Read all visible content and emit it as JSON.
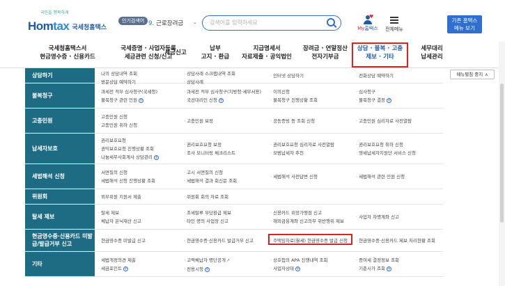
{
  "header": {
    "logo_tagline": "국민을 행복하게",
    "logo_home": "Hom",
    "logo_tax": "tax",
    "logo_sub": "국세청홈택스",
    "popular_badge": "인기검색어",
    "popular_num": "9.",
    "popular_term": "근로장려금",
    "search_placeholder": "검색어를 입력하세요",
    "mytax_label_red": "My",
    "mytax_label_blue": "홈택스",
    "allmenu_label": "전체메뉴",
    "basic_btn_line1": "기존 홈택스",
    "basic_btn_line2": "메뉴 보기"
  },
  "nav": [
    {
      "l1": "국세청홈택스서",
      "l2": "현금영수증 · 신용카드"
    },
    {
      "l1": "국세증명 · 사업자등록",
      "l2": "세금관련 신청/신고"
    },
    {
      "l1": "세금신고",
      "l2": ""
    },
    {
      "l1": "납부",
      "l2": "고지 · 환급"
    },
    {
      "l1": "지급명세서",
      "l2": "자료제출 · 공익법인"
    },
    {
      "l1": "장려금 · 연말정산",
      "l2": "전자기부금"
    },
    {
      "l1": "상담 · 불복 · 고충",
      "l2": "제보 · 기타"
    },
    {
      "l1": "세무대리",
      "l2": "납세관리"
    }
  ],
  "hide_button": "메뉴펼침 중지",
  "rows": [
    {
      "head": "상담하기",
      "cells": [
        [
          "나의 상담내역 조회",
          "방문상담 예약하기"
        ],
        [
          "상담사례 스크랩내역 조회",
          "상담사례"
        ],
        [
          "인터넷 상담하기"
        ],
        [
          "전화상담 예약하기"
        ]
      ]
    },
    {
      "head": "불복청구",
      "cells": [
        [
          "과세전 적부 심사청구(국세청)",
          "불복청구 관련 민원"
        ],
        [
          "과세전 적부 심사청구(지방청·세무서용)",
          "국선대리인 신청"
        ],
        [
          "이의신청",
          "불복청구 진행상황 조회"
        ],
        [
          "심사청구",
          "불복청구 결정"
        ]
      ]
    },
    {
      "head": "고충민원",
      "cells": [
        [
          "고충민원 신청",
          "고충민원 취하 신청"
        ],
        [
          "고충민원 보정"
        ],
        [
          "공동증빙 등 조회 신청"
        ],
        [
          "고충민원 심리자료 사전열람"
        ]
      ]
    },
    {
      "head": "납세자보호",
      "cells": [
        [
          "권리보호요청",
          "권익보호요청 진행상황 조회",
          "나눔세무사회계사 상담관리"
        ],
        [
          "권리보호요청 보정",
          "조사 모니터링 체크리스트"
        ],
        [
          "권리보호요청 심리자료 사전열람",
          "모범납세자 추천"
        ],
        [
          "권리보호요청 취하 신청",
          "영세납세자지원단 서비스 신청"
        ]
      ]
    },
    {
      "head": "세법해석 신청",
      "cells": [
        [
          "서면질의 신청",
          "세법해석 신청 진행상황 조회"
        ],
        [
          "고시 서면질의 신청",
          "세법해석 결과 회신문 조회"
        ],
        [
          "세법해석 사전답변 신청"
        ],
        [
          "세법해석 관련 민원 신청"
        ]
      ]
    },
    {
      "head": "위원회",
      "cells": [
        [
          "외부위원 지원서 제출"
        ],
        [
          "위원회 회의 자료 조회"
        ],
        [],
        []
      ]
    },
    {
      "head": "탈세 제보",
      "cells": [
        [
          "탈세 제보",
          "체납자 은닉재산 신고"
        ],
        [
          "조세탈루 부당환급 제보",
          "타인 명의 사업장 신고"
        ],
        [
          "신용카드 위장가맹점 신고",
          "해외금융계좌 신고의무 위반행위 제보"
        ],
        [
          "사업자 차명계좌 신고"
        ]
      ]
    },
    {
      "head": "현금영수증·신용카드 미발급/발급거부 신고",
      "cells": [
        [
          "현금영수증 미발급 신고"
        ],
        [
          "현금영수증·신용카드 발급거부 신고"
        ],
        [
          "주택임차료(월세) 현금영수증 발급 신청"
        ],
        [
          "현금영수증·신용카드 제보 처리현황 조회"
        ]
      ]
    },
    {
      "head": "기타",
      "cells": [
        [
          "세법개정의견 제출",
          "세금포인트"
        ],
        [
          "고액체납자 명단공개",
          "전용시청"
        ],
        [
          "상호접의 APA 진행내역 조회",
          "사업자상태"
        ],
        [
          "증여세 결정정보 조회",
          "기준시가 조회"
        ]
      ]
    }
  ]
}
